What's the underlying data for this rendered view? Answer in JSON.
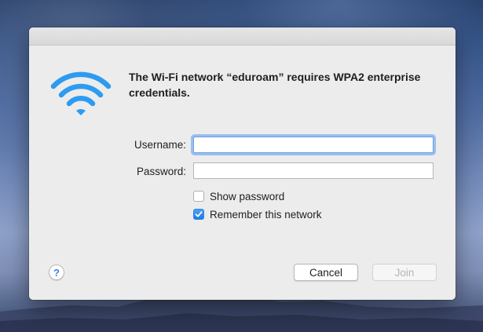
{
  "dialog": {
    "message": "The Wi-Fi network “eduroam” requires WPA2 enterprise credentials.",
    "icon": "wifi-icon",
    "accent_color": "#2e9bf0"
  },
  "form": {
    "username_label": "Username:",
    "username_value": "",
    "password_label": "Password:",
    "password_value": "",
    "show_password_label": "Show password",
    "show_password_checked": false,
    "remember_network_label": "Remember this network",
    "remember_network_checked": true
  },
  "buttons": {
    "help_label": "?",
    "cancel_label": "Cancel",
    "join_label": "Join",
    "join_enabled": false
  }
}
